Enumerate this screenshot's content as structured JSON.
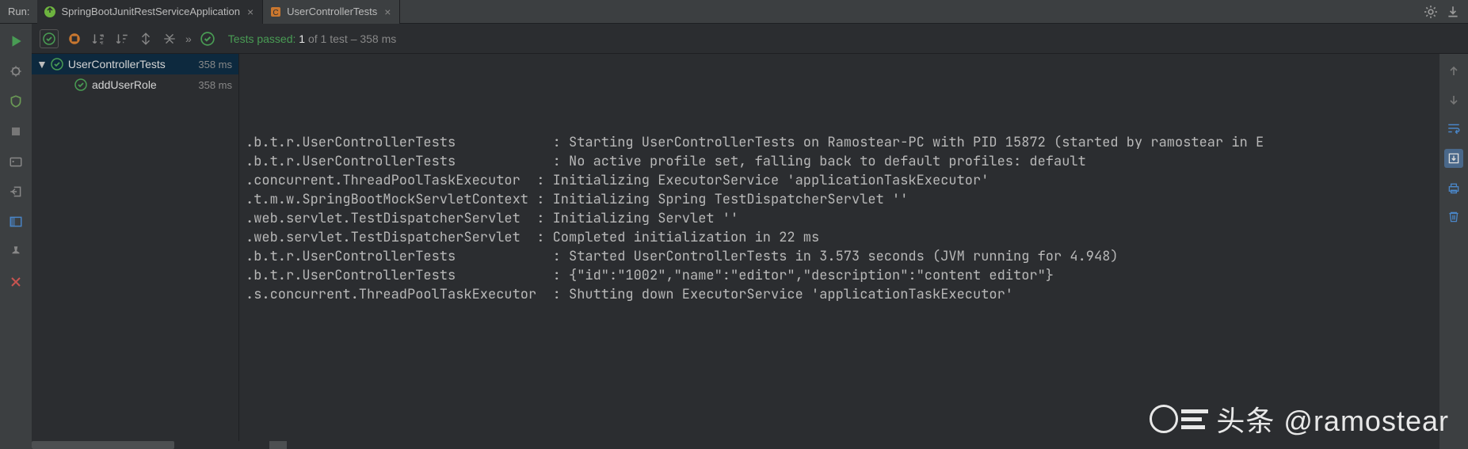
{
  "header": {
    "run_label": "Run:",
    "tabs": [
      {
        "label": "SpringBootJunitRestServiceApplication",
        "icon": "spring-boot"
      },
      {
        "label": "UserControllerTests",
        "icon": "class"
      }
    ]
  },
  "filter": {
    "status_prefix": "Tests passed:",
    "passed_count": "1",
    "of_text": "of 1 test",
    "timing": "– 358 ms"
  },
  "tree": {
    "root": {
      "name": "UserControllerTests",
      "timing": "358 ms"
    },
    "children": [
      {
        "name": "addUserRole",
        "timing": "358 ms"
      }
    ]
  },
  "console": {
    "lines": [
      {
        "src": ".b.t.r.UserControllerTests            ",
        "msg": ": Starting UserControllerTests on Ramostear-PC with PID 15872 (started by ramostear in E"
      },
      {
        "src": ".b.t.r.UserControllerTests            ",
        "msg": ": No active profile set, falling back to default profiles: default"
      },
      {
        "src": ".concurrent.ThreadPoolTaskExecutor  ",
        "msg": ": Initializing ExecutorService 'applicationTaskExecutor'"
      },
      {
        "src": ".t.m.w.SpringBootMockServletContext ",
        "msg": ": Initializing Spring TestDispatcherServlet ''"
      },
      {
        "src": ".web.servlet.TestDispatcherServlet  ",
        "msg": ": Initializing Servlet ''"
      },
      {
        "src": ".web.servlet.TestDispatcherServlet  ",
        "msg": ": Completed initialization in 22 ms"
      },
      {
        "src": ".b.t.r.UserControllerTests            ",
        "msg": ": Started UserControllerTests in 3.573 seconds (JVM running for 4.948)"
      },
      {
        "src": ".b.t.r.UserControllerTests            ",
        "msg": ": {\"id\":\"1002\",\"name\":\"editor\",\"description\":\"content editor\"}"
      },
      {
        "src": ".s.concurrent.ThreadPoolTaskExecutor  ",
        "msg": ": Shutting down ExecutorService 'applicationTaskExecutor'"
      }
    ]
  },
  "watermark": {
    "text": "头条 @ramostear"
  }
}
